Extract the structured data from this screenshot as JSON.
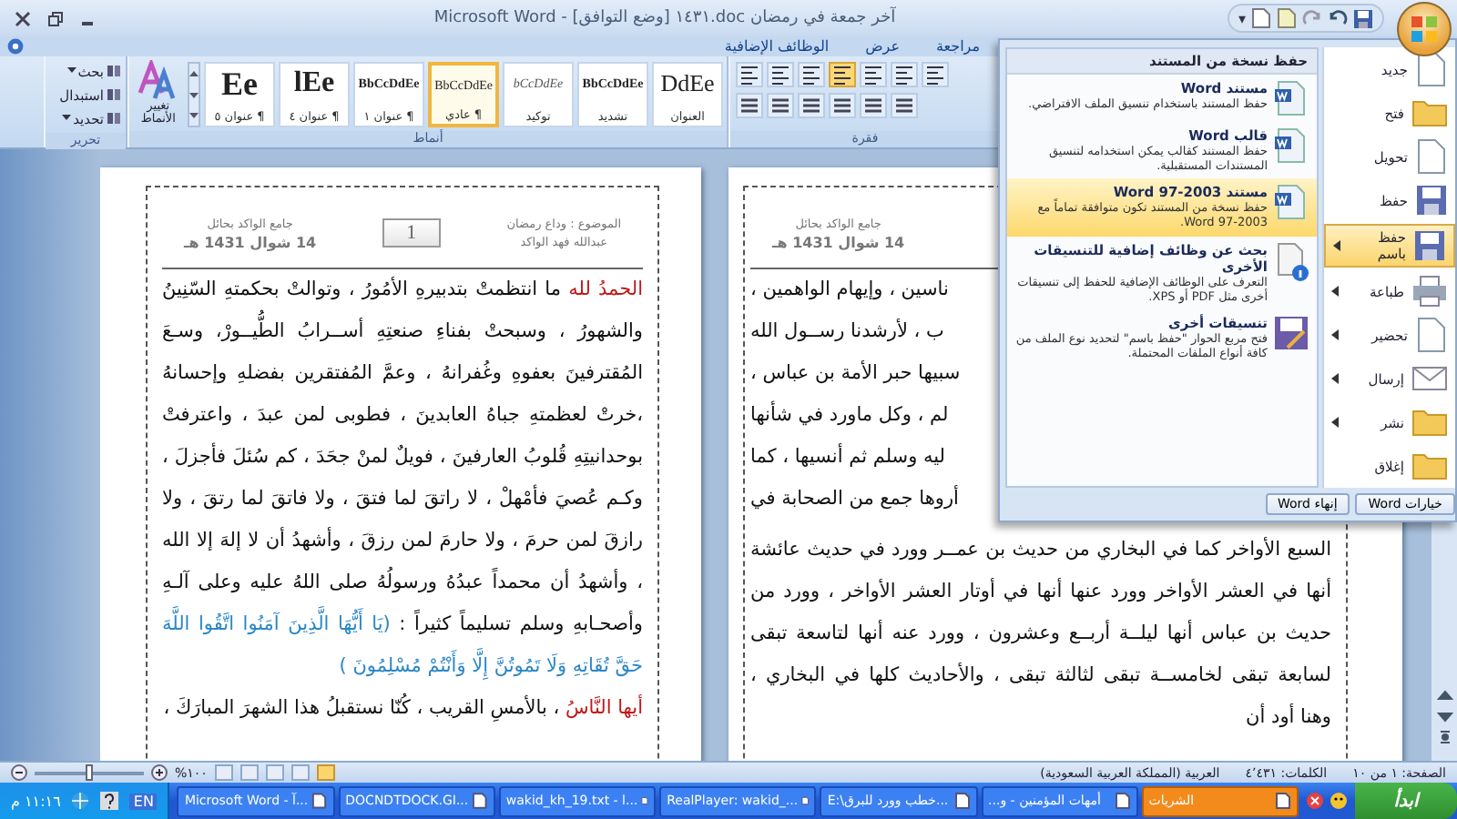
{
  "window": {
    "title": "آخر جمعة في رمضان doc.١٤٣١ [وضع التوافق] - Microsoft Word"
  },
  "quick_access": {
    "caret": "▾"
  },
  "tabs": [
    {
      "label": "مراجعة",
      "selected": false
    },
    {
      "label": "عرض",
      "selected": false
    },
    {
      "label": "الوظائف الإضافية",
      "selected": false
    }
  ],
  "ribbon": {
    "editing": {
      "label": "تحرير",
      "commands": [
        {
          "label": "بحث",
          "dropdown": true
        },
        {
          "label": "استبدال",
          "dropdown": false
        },
        {
          "label": "تحديد",
          "dropdown": true
        }
      ]
    },
    "change_styles": "تغيير الأنماط",
    "styles": {
      "label": "أنماط",
      "items": [
        {
          "preview": "DdEe",
          "name": "العنوان",
          "kind": "title",
          "selected": false
        },
        {
          "preview": "BbCcDdEe",
          "name": "تشديد",
          "kind": "bold",
          "selected": false
        },
        {
          "preview": "bCcDdEe",
          "name": "توكيد",
          "kind": "italic",
          "selected": false
        },
        {
          "preview": "BbCcDdEe",
          "name": "¶ عادي",
          "kind": "plain",
          "selected": true
        },
        {
          "preview": "BbCcDdEe",
          "name": "¶ عنوان ١",
          "kind": "bold",
          "selected": false
        },
        {
          "preview": "lEe",
          "name": "¶ عنوان ٤",
          "kind": "large",
          "selected": false
        },
        {
          "preview": "Ee",
          "name": "¶ عنوان ٥",
          "kind": "big",
          "selected": false
        }
      ]
    },
    "paragraph": {
      "label": "فقرة"
    }
  },
  "pages": [
    {
      "header": {
        "place": "جامع الواكد بحائل",
        "date": "14 شوال 1431 هـ"
      },
      "fragments": [
        "ناسين ، وإيهام الواهمين ،",
        "ب ، لأرشدنا رســول الله",
        "سبيها حبر الأمة بن عباس ،",
        "لم ، وكل ماورد في شأنها",
        "ليه وسلم ثم أنسيها ، كما",
        "أروها جمع من الصحابة في"
      ],
      "paragraphs": [
        [
          {
            "kind": "plain",
            "text": "السبع الأواخر كما في البخاري من حديث بن عمــر وورد في حديث عائشة أنها في العشر الأواخر وورد عنها أنها في أوتار العشر الأواخر ، وورد من حديث بن عباس أنها ليلــة أربــع وعشرون ، وورد عنه أنها لتاسعة تبقى لسابعة تبقى لخامســة تبقى لثالثة تبقى ، والأحاديث كلها في البخاري ، وهنا أود أن"
          }
        ]
      ]
    },
    {
      "header": {
        "subject": "الموضوع : وداع رمضان",
        "author": "عبدالله فهد الواكد",
        "page_number": "1",
        "place": "جامع الواكد بحائل",
        "date": "14 شوال 1431 هـ"
      },
      "paragraphs": [
        [
          {
            "kind": "highlight",
            "text": "الحمدُ لله"
          },
          {
            "kind": "plain",
            "text": " ما انتظمتْ بتدبيرهِ الأمُورُ ، وتوالتْ بحكمتهِ السّنِينُ والشهورُ ، وسبحتْ بفناءِ صنعتِهِ أســرابُ الطُّيــورْ، وسـعَ المُقترفينَ بعفوهِ وغُفرانهُ ، وعمَّ المُفتقرين بفضلهِ وإحسانهُ ،خرتْ لعظمتهِ جباهُ العابدينَ ، فطوبى لمن عبدَ ، واعترفتْ بوحدانيتِهِ قُلوبُ العارفينَ ، فويلٌ لمنْ جحَدَ ، كم سُئلَ فأجزلَ ، وكـم عُصيَ فأمْهلْ ، لا راتقَ لما فتقَ ، ولا فاتقَ لما رتقَ ، ولا رازقَ لمن حرمَ ، ولا حارمَ لمن رزقَ ، وأشهدُ أن لا إلهَ إلا الله ، وأشهدُ أن محمداً عبدُهُ ورسولُهُ صلى اللهُ عليه وعلى آلـهِ وأصحـابهِ وسلم تسليماً كثيراً : "
          },
          {
            "kind": "verse",
            "text": "(يَا أَيُّهَا الَّذِينَ آمَنُوا اتَّقُوا اللَّهَ حَقَّ تُقَاتِهِ وَلَا تَمُوتُنَّ إِلَّا وَأَنْتُمْ مُسْلِمُونَ )"
          }
        ],
        [
          {
            "kind": "highlight",
            "text": "أيها النَّاسُ"
          },
          {
            "kind": "plain",
            "text": " ، بالأمسِ القريب ، كُنّا نستقبلُ هذا الشهرَ المبارَكَ ،"
          }
        ]
      ]
    }
  ],
  "office_menu": {
    "commands": [
      {
        "label": "جديد",
        "submenu": false,
        "selected": false
      },
      {
        "label": "فتح",
        "submenu": false,
        "selected": false
      },
      {
        "label": "تحويل",
        "submenu": false,
        "selected": false
      },
      {
        "label": "حفظ",
        "submenu": false,
        "selected": false
      },
      {
        "label": "حفظ باسم",
        "submenu": true,
        "selected": true
      },
      {
        "label": "طباعة",
        "submenu": true,
        "selected": false
      },
      {
        "label": "تحضير",
        "submenu": true,
        "selected": false
      },
      {
        "label": "إرسال",
        "submenu": true,
        "selected": false
      },
      {
        "label": "نشر",
        "submenu": true,
        "selected": false
      },
      {
        "label": "إغلاق",
        "submenu": false,
        "selected": false
      }
    ],
    "panel": {
      "title": "حفظ نسخة من المستند",
      "options": [
        {
          "title": "مستند Word",
          "description": "حفظ المستند باستخدام تنسيق الملف الافتراضي.",
          "selected": false
        },
        {
          "title": "قالب Word",
          "description": "حفظ المستند كقالب يمكن استخدامه لتنسيق المستندات المستقبلية.",
          "selected": false
        },
        {
          "title": "مستند Word 97-2003",
          "description": "حفظ نسخة من المستند تكون متوافقة تماماً مع Word 97-2003.",
          "selected": true
        },
        {
          "title": "بحث عن وظائف إضافية للتنسيقات الأخرى",
          "description": "التعرف على الوظائف الإضافية للحفظ إلى تنسيقات أخرى مثل PDF أو XPS.",
          "selected": false
        },
        {
          "title": "تنسيقات أخرى",
          "description": "فتح مربع الحوار \"حفظ باسم\" لتحديد نوع الملف من كافة أنواع الملفات المحتملة.",
          "selected": false
        }
      ]
    },
    "buttons": [
      "خيارات Word",
      "إنهاء Word"
    ]
  },
  "status_bar": {
    "page": "الصفحة: ١ من ١٠",
    "words": "الكلمات: ٤٬٤٣١",
    "language": "العربية (المملكة العربية السعودية)",
    "zoom": "%١٠٠",
    "zoom_slider": {
      "level": 0.5
    },
    "views": [
      {
        "selected": false
      },
      {
        "selected": false
      },
      {
        "selected": false
      },
      {
        "selected": false
      },
      {
        "selected": true
      }
    ]
  },
  "taskbar": {
    "start": "ابدأ",
    "buttons": [
      {
        "label": "الشريات",
        "flashing": true
      },
      {
        "label": "أمهات المؤمنين - و...",
        "flashing": false
      },
      {
        "label": "E:\\خطب وورد للبرق...",
        "flashing": false
      },
      {
        "label": "RealPlayer: wakid_...",
        "flashing": false
      },
      {
        "label": "wakid_kh_19.txt - l...",
        "flashing": false
      },
      {
        "label": "DOCNDTDOCK.GI...",
        "flashing": false
      },
      {
        "label": "Microsoft Word - آ...",
        "flashing": false
      }
    ],
    "language": "EN",
    "clock": "١١:١٦ م"
  }
}
